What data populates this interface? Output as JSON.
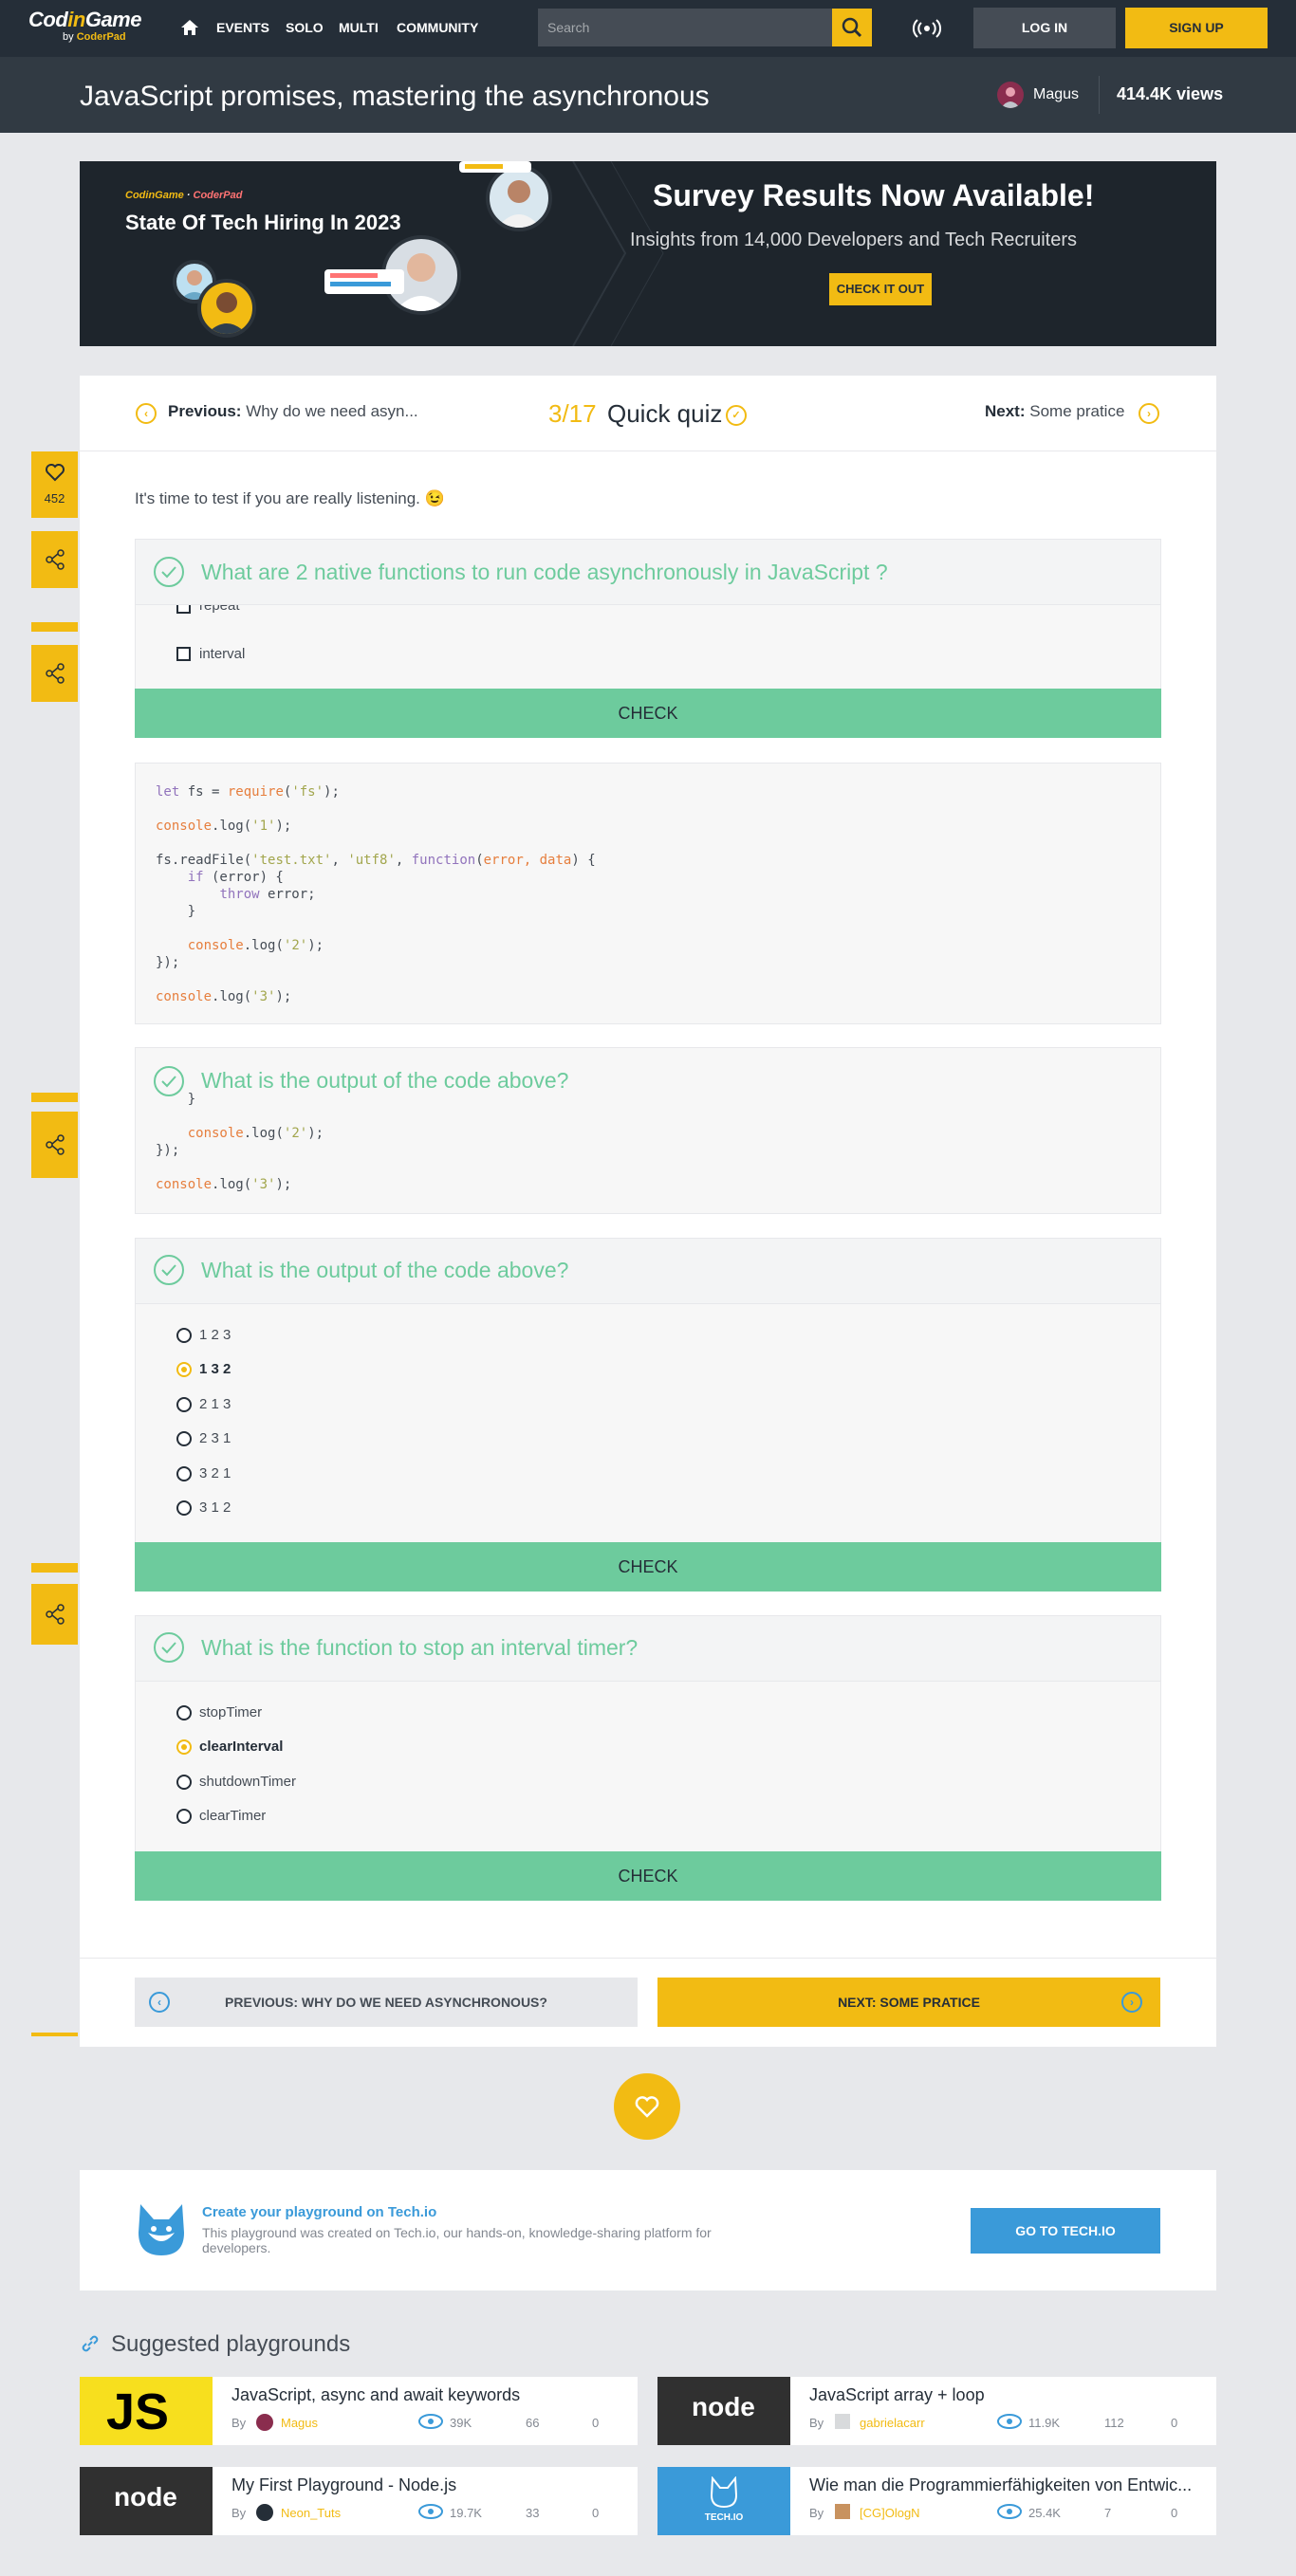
{
  "nav": {
    "brand_a": "Cod",
    "brand_b": "in",
    "brand_c": "Game",
    "brand_by": "by",
    "brand_coderpad": "CoderPad",
    "links": [
      "EVENTS",
      "SOLO",
      "MULTI",
      "COMMUNITY"
    ],
    "search_placeholder": "Search",
    "login": "LOG IN",
    "signup": "SIGN UP"
  },
  "header": {
    "title": "JavaScript promises, mastering the asynchronous",
    "author": "Magus",
    "views": "414.4K views"
  },
  "banner": {
    "logo_a": "CodinGame",
    "logo_b": "CoderPad",
    "headline": "State Of Tech Hiring In 2023",
    "title": "Survey Results Now Available!",
    "subtitle": "Insights from 14,000 Developers and Tech Recruiters",
    "button": "CHECK IT OUT"
  },
  "lesson": {
    "prev_label": "Previous:",
    "prev_title": "Why do we need asyn...",
    "step": "3/17",
    "step_title": "Quick quiz",
    "next_label": "Next:",
    "next_title": "Some pratice",
    "likes": "452",
    "intro": "It's time to test if you are really listening. 😉"
  },
  "quiz1": {
    "question": "What are 2 native functions to run code asynchronously in JavaScript ?",
    "options": [
      "repeat",
      "interval"
    ],
    "check": "CHECK"
  },
  "code": {
    "lines": [
      "let fs = require('fs');",
      "",
      "console.log('1');",
      "",
      "fs.readFile('test.txt', 'utf8', function(error, data) {",
      "    if (error) {",
      "        throw error;",
      "    }",
      "",
      "    console.log('2');",
      "});",
      "",
      "console.log('3');"
    ]
  },
  "quiz2": {
    "question": "What is the output of the code above?",
    "code_tail": [
      "    }",
      "",
      "    console.log('2');",
      "});",
      "",
      "console.log('3');"
    ]
  },
  "quiz3": {
    "question": "What is the output of the code above?",
    "options": [
      "1 2 3",
      "1 3 2",
      "2 1 3",
      "2 3 1",
      "3 2 1",
      "3 1 2"
    ],
    "selected": 1,
    "check": "CHECK"
  },
  "quiz4": {
    "question": "What is the function to stop an interval timer?",
    "options": [
      "stopTimer",
      "clearInterval",
      "shutdownTimer",
      "clearTimer"
    ],
    "selected": 1,
    "check": "CHECK"
  },
  "bottomnav": {
    "prev": "PREVIOUS: WHY DO WE NEED ASYNCHRONOUS?",
    "next": "NEXT: SOME PRATICE"
  },
  "techio": {
    "title": "Create your playground on Tech.io",
    "desc": "This playground was created on Tech.io, our hands-on, knowledge-sharing platform for developers.",
    "button": "GO TO TECH.IO"
  },
  "suggested": {
    "heading": "Suggested playgrounds",
    "by": "By",
    "cards": [
      {
        "title": "JavaScript, async and await keywords",
        "author": "Magus",
        "views": "39K",
        "likes": "66",
        "comments": "0",
        "thumb": "JS"
      },
      {
        "title": "JavaScript array + loop",
        "author": "gabrielacarr",
        "views": "11.9K",
        "likes": "112",
        "comments": "0",
        "thumb": "node"
      },
      {
        "title": "My First Playground - Node.js",
        "author": "Neon_Tuts",
        "views": "19.7K",
        "likes": "33",
        "comments": "0",
        "thumb": "node"
      },
      {
        "title": "Wie man die Programmierfähigkeiten von Entwic...",
        "author": "[CG]OlogN",
        "views": "25.4K",
        "likes": "7",
        "comments": "0",
        "thumb": "TECH.IO"
      }
    ]
  },
  "colors": {
    "accent": "#f2bb13",
    "success": "#6dcb9d",
    "dark": "#252e38",
    "link": "#3a9ad9"
  }
}
